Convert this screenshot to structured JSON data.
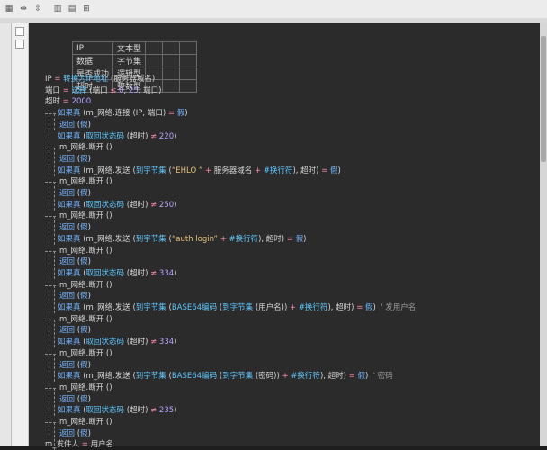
{
  "vars": [
    {
      "name": "IP",
      "type": "文本型"
    },
    {
      "name": "数据",
      "type": "字节集"
    },
    {
      "name": "是否成功",
      "type": "逻辑型"
    },
    {
      "name": "超时",
      "type": "整数型"
    }
  ],
  "code": [
    [
      [
        "v",
        "IP "
      ],
      [
        "op",
        "= "
      ],
      [
        "fn",
        "转换为IP地址"
      ],
      [
        "v",
        " (服务器域名)"
      ]
    ],
    [
      [
        "v",
        "端口 "
      ],
      [
        "op",
        "= "
      ],
      [
        "fn",
        "选择"
      ],
      [
        "v",
        " (端口 "
      ],
      [
        "op",
        "≤"
      ],
      [
        "num",
        " 0"
      ],
      [
        "v",
        ", "
      ],
      [
        "num",
        "25"
      ],
      [
        "v",
        ", 端口)"
      ]
    ],
    [
      [
        "v",
        "超时 "
      ],
      [
        "op",
        "= "
      ],
      [
        "num",
        "2000"
      ]
    ],
    [
      [
        "kw",
        "如果真"
      ],
      [
        "v",
        " (m_网络.连接 (IP, 端口) "
      ],
      [
        "op",
        "= "
      ],
      [
        "kw",
        "假"
      ],
      [
        "v",
        ")"
      ]
    ],
    [
      [
        "kw",
        "返回"
      ],
      [
        "v",
        " ("
      ],
      [
        "kw",
        "假"
      ],
      [
        "v",
        ")"
      ]
    ],
    [
      [
        "kw",
        "如果真"
      ],
      [
        "v",
        " ("
      ],
      [
        "fn",
        "取回状态码"
      ],
      [
        "v",
        " (超时) "
      ],
      [
        "op",
        "≠"
      ],
      [
        "num",
        " 220"
      ],
      [
        "v",
        ")"
      ]
    ],
    [
      [
        "v",
        "m_网络.断开 ()"
      ]
    ],
    [
      [
        "kw",
        "返回"
      ],
      [
        "v",
        " ("
      ],
      [
        "kw",
        "假"
      ],
      [
        "v",
        ")"
      ]
    ],
    [
      [
        "kw",
        "如果真"
      ],
      [
        "v",
        " (m_网络.发送 ("
      ],
      [
        "fn",
        "到字节集"
      ],
      [
        "v",
        " ("
      ],
      [
        "str",
        "“EHLO ”"
      ],
      [
        "op",
        " + "
      ],
      [
        "v",
        "服务器域名 "
      ],
      [
        "op",
        "+ "
      ],
      [
        "fn",
        "#换行符"
      ],
      [
        "v",
        "), 超时) "
      ],
      [
        "op",
        "= "
      ],
      [
        "kw",
        "假"
      ],
      [
        "v",
        ")"
      ]
    ],
    [
      [
        "v",
        "m_网络.断开 ()"
      ]
    ],
    [
      [
        "kw",
        "返回"
      ],
      [
        "v",
        " ("
      ],
      [
        "kw",
        "假"
      ],
      [
        "v",
        ")"
      ]
    ],
    [
      [
        "kw",
        "如果真"
      ],
      [
        "v",
        " ("
      ],
      [
        "fn",
        "取回状态码"
      ],
      [
        "v",
        " (超时) "
      ],
      [
        "op",
        "≠"
      ],
      [
        "num",
        " 250"
      ],
      [
        "v",
        ")"
      ]
    ],
    [
      [
        "v",
        "m_网络.断开 ()"
      ]
    ],
    [
      [
        "kw",
        "返回"
      ],
      [
        "v",
        " ("
      ],
      [
        "kw",
        "假"
      ],
      [
        "v",
        ")"
      ]
    ],
    [
      [
        "kw",
        "如果真"
      ],
      [
        "v",
        " (m_网络.发送 ("
      ],
      [
        "fn",
        "到字节集"
      ],
      [
        "v",
        " ("
      ],
      [
        "str",
        "“auth login”"
      ],
      [
        "op",
        " + "
      ],
      [
        "fn",
        "#换行符"
      ],
      [
        "v",
        "), 超时) "
      ],
      [
        "op",
        "= "
      ],
      [
        "kw",
        "假"
      ],
      [
        "v",
        ")"
      ]
    ],
    [
      [
        "v",
        "m_网络.断开 ()"
      ]
    ],
    [
      [
        "kw",
        "返回"
      ],
      [
        "v",
        " ("
      ],
      [
        "kw",
        "假"
      ],
      [
        "v",
        ")"
      ]
    ],
    [
      [
        "kw",
        "如果真"
      ],
      [
        "v",
        " ("
      ],
      [
        "fn",
        "取回状态码"
      ],
      [
        "v",
        " (超时) "
      ],
      [
        "op",
        "≠"
      ],
      [
        "num",
        " 334"
      ],
      [
        "v",
        ")"
      ]
    ],
    [
      [
        "v",
        "m_网络.断开 ()"
      ]
    ],
    [
      [
        "kw",
        "返回"
      ],
      [
        "v",
        " ("
      ],
      [
        "kw",
        "假"
      ],
      [
        "v",
        ")"
      ]
    ],
    [
      [
        "kw",
        "如果真"
      ],
      [
        "v",
        " (m_网络.发送 ("
      ],
      [
        "fn",
        "到字节集"
      ],
      [
        "v",
        " ("
      ],
      [
        "fn",
        "BASE64编码"
      ],
      [
        "v",
        " ("
      ],
      [
        "fn",
        "到字节集"
      ],
      [
        "v",
        " (用户名)) "
      ],
      [
        "op",
        "+ "
      ],
      [
        "fn",
        "#换行符"
      ],
      [
        "v",
        "), 超时) "
      ],
      [
        "op",
        "= "
      ],
      [
        "kw",
        "假"
      ],
      [
        "v",
        ")  "
      ],
      [
        "cmt",
        "' 发用户名"
      ]
    ],
    [
      [
        "v",
        "m_网络.断开 ()"
      ]
    ],
    [
      [
        "kw",
        "返回"
      ],
      [
        "v",
        " ("
      ],
      [
        "kw",
        "假"
      ],
      [
        "v",
        ")"
      ]
    ],
    [
      [
        "kw",
        "如果真"
      ],
      [
        "v",
        " ("
      ],
      [
        "fn",
        "取回状态码"
      ],
      [
        "v",
        " (超时) "
      ],
      [
        "op",
        "≠"
      ],
      [
        "num",
        " 334"
      ],
      [
        "v",
        ")"
      ]
    ],
    [
      [
        "v",
        "m_网络.断开 ()"
      ]
    ],
    [
      [
        "kw",
        "返回"
      ],
      [
        "v",
        " ("
      ],
      [
        "kw",
        "假"
      ],
      [
        "v",
        ")"
      ]
    ],
    [
      [
        "kw",
        "如果真"
      ],
      [
        "v",
        " (m_网络.发送 ("
      ],
      [
        "fn",
        "到字节集"
      ],
      [
        "v",
        " ("
      ],
      [
        "fn",
        "BASE64编码"
      ],
      [
        "v",
        " ("
      ],
      [
        "fn",
        "到字节集"
      ],
      [
        "v",
        " (密码)) "
      ],
      [
        "op",
        "+ "
      ],
      [
        "fn",
        "#换行符"
      ],
      [
        "v",
        "), 超时) "
      ],
      [
        "op",
        "= "
      ],
      [
        "kw",
        "假"
      ],
      [
        "v",
        ")  "
      ],
      [
        "cmt",
        "' 密码"
      ]
    ],
    [
      [
        "v",
        "m_网络.断开 ()"
      ]
    ],
    [
      [
        "kw",
        "返回"
      ],
      [
        "v",
        " ("
      ],
      [
        "kw",
        "假"
      ],
      [
        "v",
        ")"
      ]
    ],
    [
      [
        "kw",
        "如果真"
      ],
      [
        "v",
        " ("
      ],
      [
        "fn",
        "取回状态码"
      ],
      [
        "v",
        " (超时) "
      ],
      [
        "op",
        "≠"
      ],
      [
        "num",
        " 235"
      ],
      [
        "v",
        ")"
      ]
    ],
    [
      [
        "v",
        "m_网络.断开 ()"
      ]
    ],
    [
      [
        "kw",
        "返回"
      ],
      [
        "v",
        " ("
      ],
      [
        "kw",
        "假"
      ],
      [
        "v",
        ")"
      ]
    ],
    [
      [
        "v",
        "m_发件人 "
      ],
      [
        "op",
        "= "
      ],
      [
        "v",
        "用户名"
      ]
    ]
  ],
  "colors": {
    "editor_bg": "#2b2b2b",
    "keyword": "#6fb3ff",
    "operator": "#ff8aa8",
    "number": "#b9a3ff",
    "string": "#e6c07b"
  },
  "toolbar_icons": [
    "grid-icon",
    "fit-width-icon",
    "fit-height-icon",
    "column-icon",
    "row-icon",
    "split-icon"
  ]
}
